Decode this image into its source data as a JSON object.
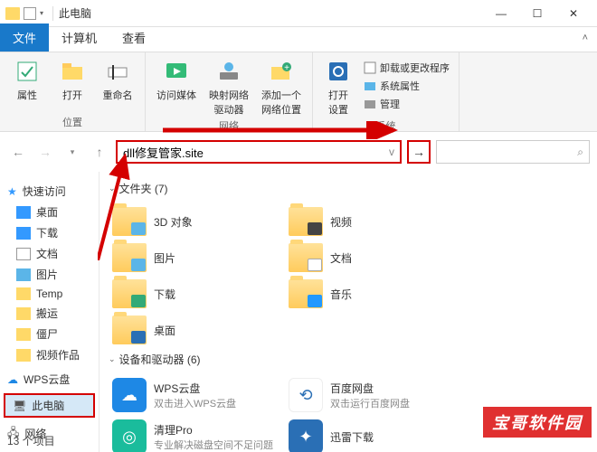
{
  "titlebar": {
    "title": "此电脑"
  },
  "tabs": {
    "file": "文件",
    "computer": "计算机",
    "view": "查看"
  },
  "ribbon": {
    "group1": {
      "label": "位置",
      "properties": "属性",
      "open": "打开",
      "rename": "重命名"
    },
    "group2": {
      "label": "网络",
      "media": "访问媒体",
      "map_drive": "映射网络\n驱动器",
      "add_location": "添加一个\n网络位置"
    },
    "group3": {
      "label": "系统",
      "open_settings": "打开\n设置",
      "uninstall": "卸载或更改程序",
      "sys_props": "系统属性",
      "manage": "管理"
    }
  },
  "address": {
    "value": "dll修复管家.site",
    "dropdown_v": "v"
  },
  "sidebar": {
    "quick_access": "快速访问",
    "desktop": "桌面",
    "downloads": "下载",
    "documents": "文档",
    "pictures": "图片",
    "temp": "Temp",
    "moving": "搬运",
    "zombie": "僵尸",
    "video_works": "视频作品",
    "wps": "WPS云盘",
    "this_pc": "此电脑",
    "network": "网络"
  },
  "main": {
    "folders_header": "文件夹 (7)",
    "devices_header": "设备和驱动器 (6)",
    "folders": {
      "threeDObjects": "3D 对象",
      "videos": "视频",
      "pictures": "图片",
      "documents": "文档",
      "downloads": "下载",
      "music": "音乐",
      "desktop": "桌面"
    },
    "devices": {
      "wps": {
        "name": "WPS云盘",
        "sub": "双击进入WPS云盘"
      },
      "baidu": {
        "name": "百度网盘",
        "sub": "双击运行百度网盘"
      },
      "cleanerPro": {
        "name": "清理Pro",
        "sub": "专业解决磁盘空间不足问题"
      },
      "xunlei": {
        "name": "迅雷下载",
        "sub": ""
      }
    }
  },
  "statusbar": {
    "items": "13 个项目"
  },
  "watermark": "宝哥软件园"
}
